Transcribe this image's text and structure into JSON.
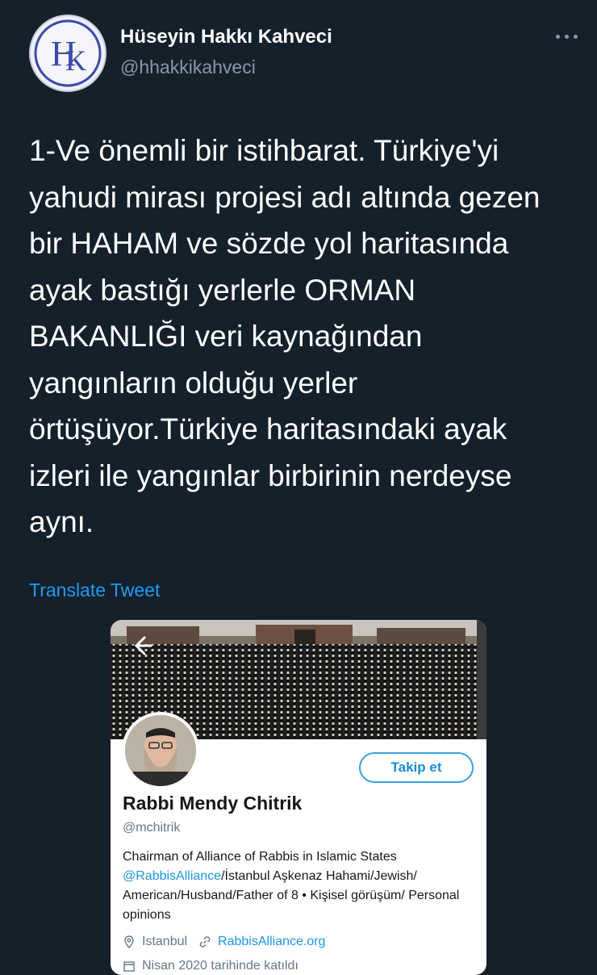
{
  "tweet": {
    "author_name": "Hüseyin Hakkı Kahveci",
    "author_handle": "@hhakkikahveci",
    "avatar_logo": "HK monogram logo",
    "text": "1-Ve önemli bir istihbarat.  Türkiye'yi\nyahudi mirası projesi adı altında gezen\nbir HAHAM ve sözde yol haritasında\nayak bastığı yerlerle ORMAN\nBAKANLIĞI veri kaynağından\nyangınların olduğu yerler\nörtüşüyor.Türkiye haritasındaki ayak\nizleri ile yangınlar birbirinin nerdeyse\naynı.",
    "translate_label": "Translate Tweet"
  },
  "profile_card": {
    "follow_label": "Takip et",
    "name": "Rabbi Mendy Chitrik",
    "handle": "@mchitrik",
    "bio_line1": "Chairman of Alliance of Rabbis in Islamic States",
    "bio_mention": "@RabbisAlliance",
    "bio_rest": "/İstanbul Aşkenaz Hahami/Jewish/ American/Husband/Father of 8 • Kişisel görüşüm/ Personal opinions",
    "location": "Istanbul",
    "website": "RabbisAlliance.org",
    "joined_partial": "Nisan 2020 tarihinde katıldı"
  },
  "colors": {
    "background": "#15202b",
    "accent": "#1d9bf0",
    "muted": "#8899a6"
  }
}
